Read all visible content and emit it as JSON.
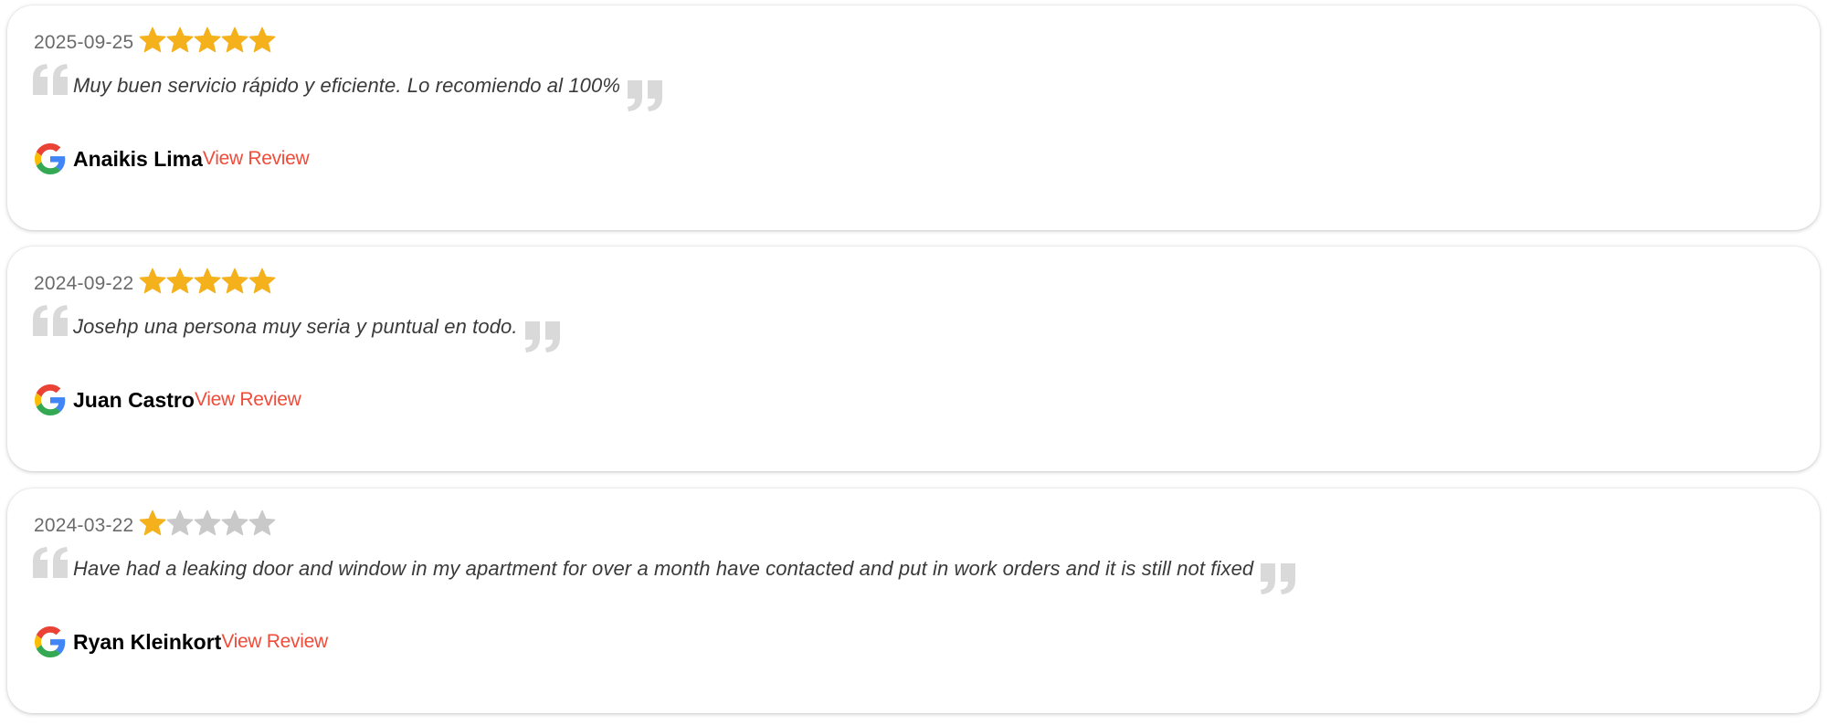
{
  "colors": {
    "star_filled": "#f5b11c",
    "star_empty": "#c9c9c9",
    "quote_mark": "#d9d9d9",
    "link": "#ef4c3a",
    "date": "#6b6b6b"
  },
  "icons": {
    "source": "google-icon",
    "star": "star-icon",
    "quote_open": "quote-open-icon",
    "quote_close": "quote-close-icon"
  },
  "reviews": [
    {
      "date": "2025-09-25",
      "rating": 5,
      "rating_max": 5,
      "text": "Muy buen servicio rápido y eficiente. Lo recomiendo al 100%",
      "author": "Anaikis Lima",
      "link_label": "View Review"
    },
    {
      "date": "2024-09-22",
      "rating": 5,
      "rating_max": 5,
      "text": "Josehp una persona muy seria y puntual en todo.",
      "author": "Juan Castro",
      "link_label": "View Review"
    },
    {
      "date": "2024-03-22",
      "rating": 1,
      "rating_max": 5,
      "text": "Have had a leaking door and window in my apartment for over a month have contacted and put in work orders and it is still not fixed",
      "author": "Ryan Kleinkort",
      "link_label": "View Review"
    }
  ]
}
